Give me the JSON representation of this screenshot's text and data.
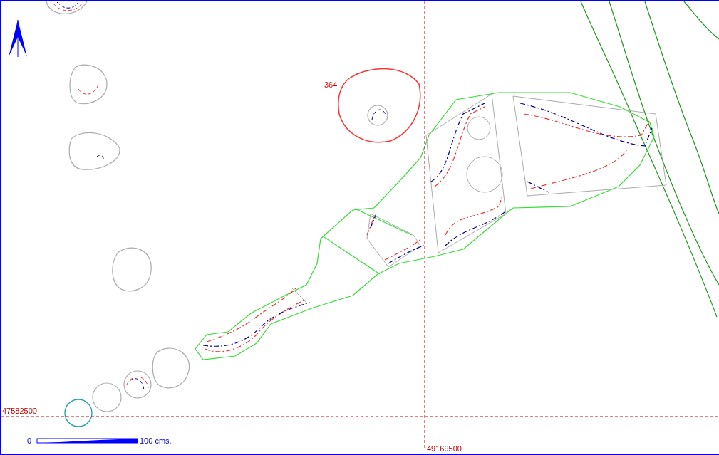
{
  "feature_label": "364",
  "grid": {
    "northing_label": "47582500",
    "easting_label": "49169500"
  },
  "scale_bar": {
    "start": "0",
    "end": "100 cms."
  }
}
